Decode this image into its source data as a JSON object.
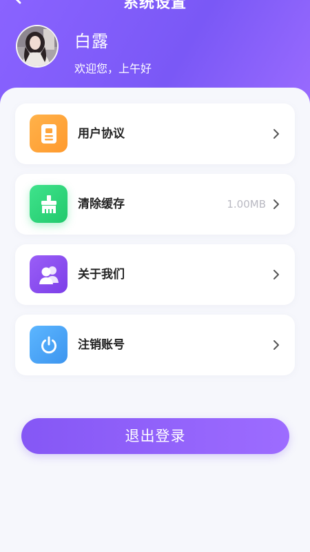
{
  "header": {
    "title": "系统设置",
    "user_name": "白露",
    "greeting": "欢迎您，上午好"
  },
  "settings": {
    "items": [
      {
        "label": "用户协议",
        "value": "",
        "icon": "document-icon",
        "color": "#ffa53b"
      },
      {
        "label": "清除缓存",
        "value": "1.00MB",
        "icon": "broom-icon",
        "color": "#2fd67b"
      },
      {
        "label": "关于我们",
        "value": "",
        "icon": "users-icon",
        "color": "#8f52f2"
      },
      {
        "label": "注销账号",
        "value": "",
        "icon": "power-icon",
        "color": "#4aa4f7"
      }
    ]
  },
  "logout": {
    "label": "退出登录"
  },
  "colors": {
    "accent": "#8a63ff",
    "background": "#f6f7fc"
  }
}
